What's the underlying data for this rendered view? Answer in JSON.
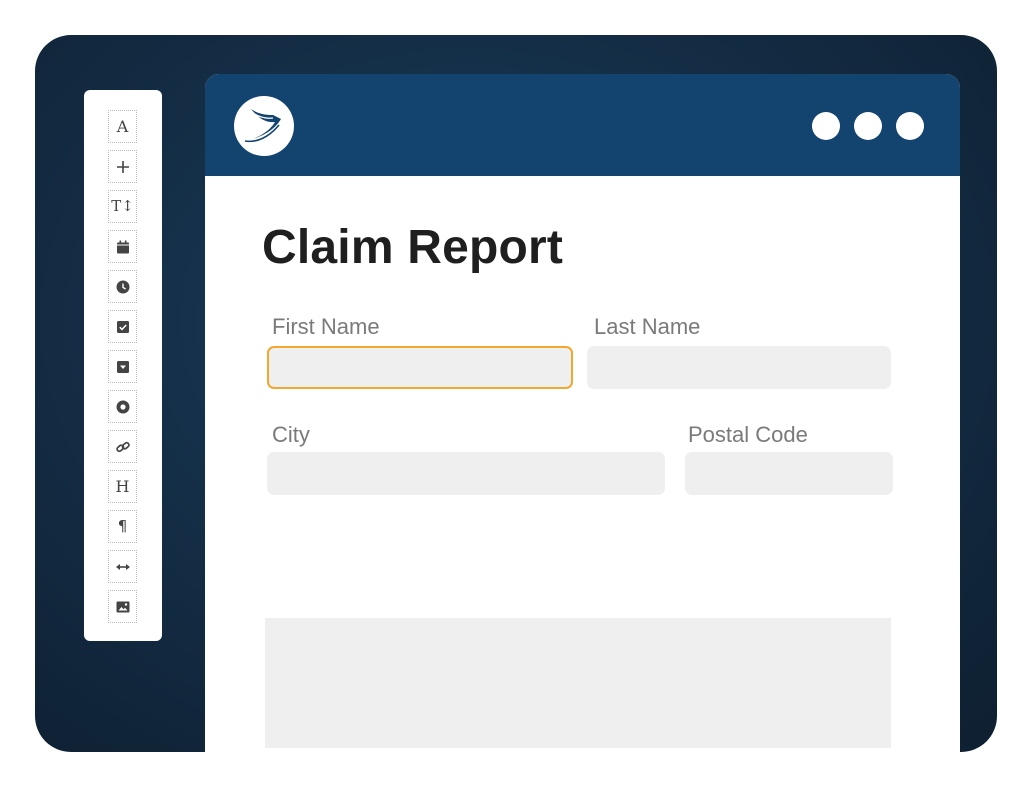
{
  "form": {
    "title": "Claim Report",
    "fields": {
      "first_name": {
        "label": "First Name",
        "value": ""
      },
      "last_name": {
        "label": "Last Name",
        "value": ""
      },
      "city": {
        "label": "City",
        "value": ""
      },
      "postal_code": {
        "label": "Postal Code",
        "value": ""
      }
    },
    "focused_field": "first_name"
  },
  "window": {
    "controls": [
      "menu-dot",
      "menu-dot",
      "menu-dot"
    ]
  },
  "toolbar": {
    "tools": [
      {
        "name": "text-tool",
        "glyph": "A"
      },
      {
        "name": "add-tool",
        "icon": "plus-icon"
      },
      {
        "name": "text-size-tool",
        "glyph": "T↕"
      },
      {
        "name": "date-tool",
        "icon": "calendar-icon"
      },
      {
        "name": "time-tool",
        "icon": "clock-icon"
      },
      {
        "name": "checkbox-tool",
        "icon": "checkbox-icon"
      },
      {
        "name": "dropdown-tool",
        "icon": "dropdown-icon"
      },
      {
        "name": "radio-tool",
        "icon": "radio-icon"
      },
      {
        "name": "link-tool",
        "icon": "link-icon"
      },
      {
        "name": "heading-tool",
        "glyph": "H"
      },
      {
        "name": "paragraph-tool",
        "glyph": "¶"
      },
      {
        "name": "divider-tool",
        "icon": "resize-horizontal-icon"
      },
      {
        "name": "image-tool",
        "icon": "image-icon"
      }
    ]
  },
  "colors": {
    "titlebar": "#12446f",
    "focus_border": "#f0a830",
    "field_bg": "#efefef",
    "frame_bg": "#15304a"
  }
}
